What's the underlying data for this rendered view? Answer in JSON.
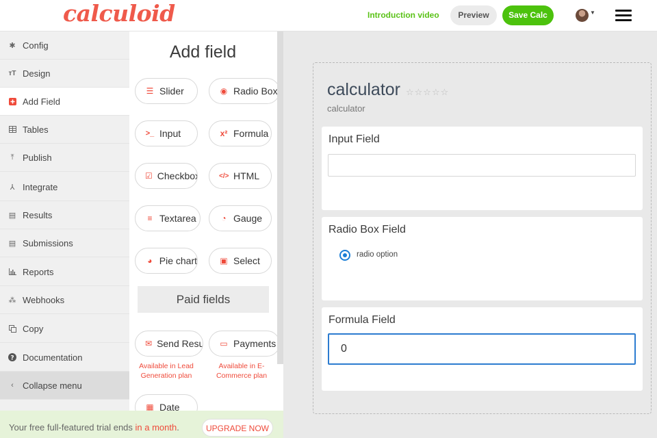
{
  "header": {
    "logo": "calculoid",
    "intro_link": "Introduction video",
    "preview_label": "Preview",
    "save_label": "Save Calc"
  },
  "sidebar": {
    "items": [
      {
        "label": "Config",
        "icon": "gear-icon"
      },
      {
        "label": "Design",
        "icon": "text-size-icon"
      },
      {
        "label": "Add Field",
        "icon": "plus-square-icon"
      },
      {
        "label": "Tables",
        "icon": "table-icon"
      },
      {
        "label": "Publish",
        "icon": "upload-icon"
      },
      {
        "label": "Integrate",
        "icon": "integrate-icon"
      },
      {
        "label": "Results",
        "icon": "archive-icon"
      },
      {
        "label": "Submissions",
        "icon": "archive-icon"
      },
      {
        "label": "Reports",
        "icon": "bar-chart-icon"
      },
      {
        "label": "Webhooks",
        "icon": "webhook-icon"
      },
      {
        "label": "Copy",
        "icon": "copy-icon"
      },
      {
        "label": "Documentation",
        "icon": "question-icon"
      },
      {
        "label": "Collapse menu",
        "icon": "chevron-left-icon"
      }
    ]
  },
  "add_field": {
    "title": "Add field",
    "buttons": [
      {
        "label": "Slider",
        "icon": "sliders-icon"
      },
      {
        "label": "Radio Box",
        "icon": "radio-icon"
      },
      {
        "label": "Input",
        "icon": "terminal-icon"
      },
      {
        "label": "Formula",
        "icon": "superscript-icon"
      },
      {
        "label": "Checkbox",
        "icon": "checkbox-icon"
      },
      {
        "label": "HTML",
        "icon": "code-icon"
      },
      {
        "label": "Textarea",
        "icon": "align-left-icon"
      },
      {
        "label": "Gauge",
        "icon": "gauge-icon"
      },
      {
        "label": "Pie chart",
        "icon": "pie-chart-icon"
      },
      {
        "label": "Select",
        "icon": "select-icon"
      }
    ],
    "paid_title": "Paid fields",
    "paid_buttons": [
      {
        "label": "Send Result",
        "icon": "envelope-icon",
        "note": "Available in Lead Generation plan"
      },
      {
        "label": "Payments",
        "icon": "money-icon",
        "note": "Available in E-Commerce plan"
      },
      {
        "label": "Date",
        "icon": "calendar-icon"
      }
    ]
  },
  "trial": {
    "text_before": "Your free full-featured trial ends ",
    "text_highlight": "in a month",
    "text_after": ".",
    "upgrade_label": "UPGRADE NOW"
  },
  "calculator": {
    "title": "calculator",
    "stars": "☆☆☆☆☆",
    "subtitle": "calculator",
    "fields": {
      "input_label": "Input Field",
      "input_value": "",
      "radio_label": "Radio Box Field",
      "radio_option": "radio option",
      "formula_label": "Formula Field",
      "formula_value": "0"
    }
  },
  "colors": {
    "brand": "#ef5a4b",
    "accent_green": "#4cc20d",
    "focus_blue": "#2b7bd0"
  }
}
